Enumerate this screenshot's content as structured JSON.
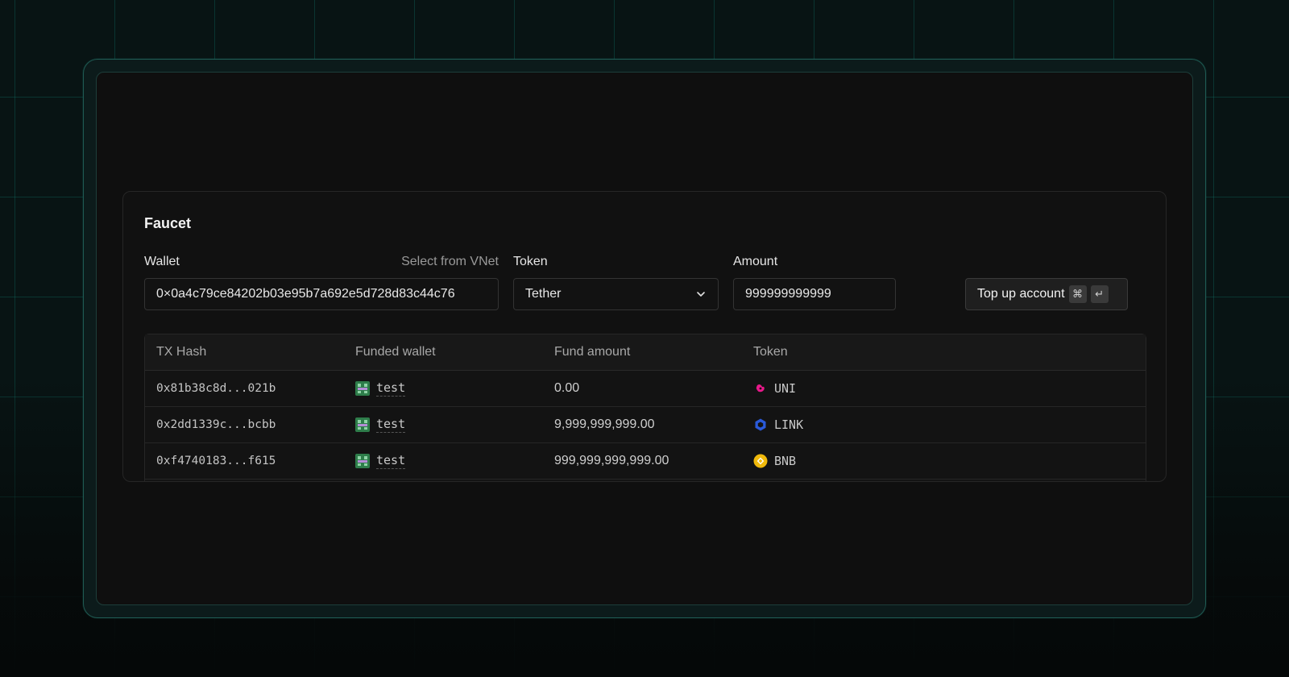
{
  "faucet": {
    "title": "Faucet",
    "wallet": {
      "label": "Wallet",
      "select_link": "Select from VNet",
      "value": "0×0a4c79ce84202b03e95b7a692e5d728d83c44c76"
    },
    "token": {
      "label": "Token",
      "selected": "Tether"
    },
    "amount": {
      "label": "Amount",
      "value": "999999999999"
    },
    "submit": {
      "label": "Top up account",
      "shortcut_cmd": "⌘",
      "shortcut_enter": "↵"
    }
  },
  "table": {
    "columns": [
      "TX Hash",
      "Funded wallet",
      "Fund amount",
      "Token"
    ],
    "rows": [
      {
        "tx_hash": "0x81b38c8d...021b",
        "wallet": "test",
        "amount": "0.00",
        "token": "UNI",
        "token_icon": "uni-icon",
        "token_color": "#e8198b"
      },
      {
        "tx_hash": "0x2dd1339c...bcbb",
        "wallet": "test",
        "amount": "9,999,999,999.00",
        "token": "LINK",
        "token_icon": "link-icon",
        "token_color": "#2a5ada"
      },
      {
        "tx_hash": "0xf4740183...f615",
        "wallet": "test",
        "amount": "999,999,999,999.00",
        "token": "BNB",
        "token_icon": "bnb-icon",
        "token_color": "#f0b90b"
      }
    ]
  }
}
